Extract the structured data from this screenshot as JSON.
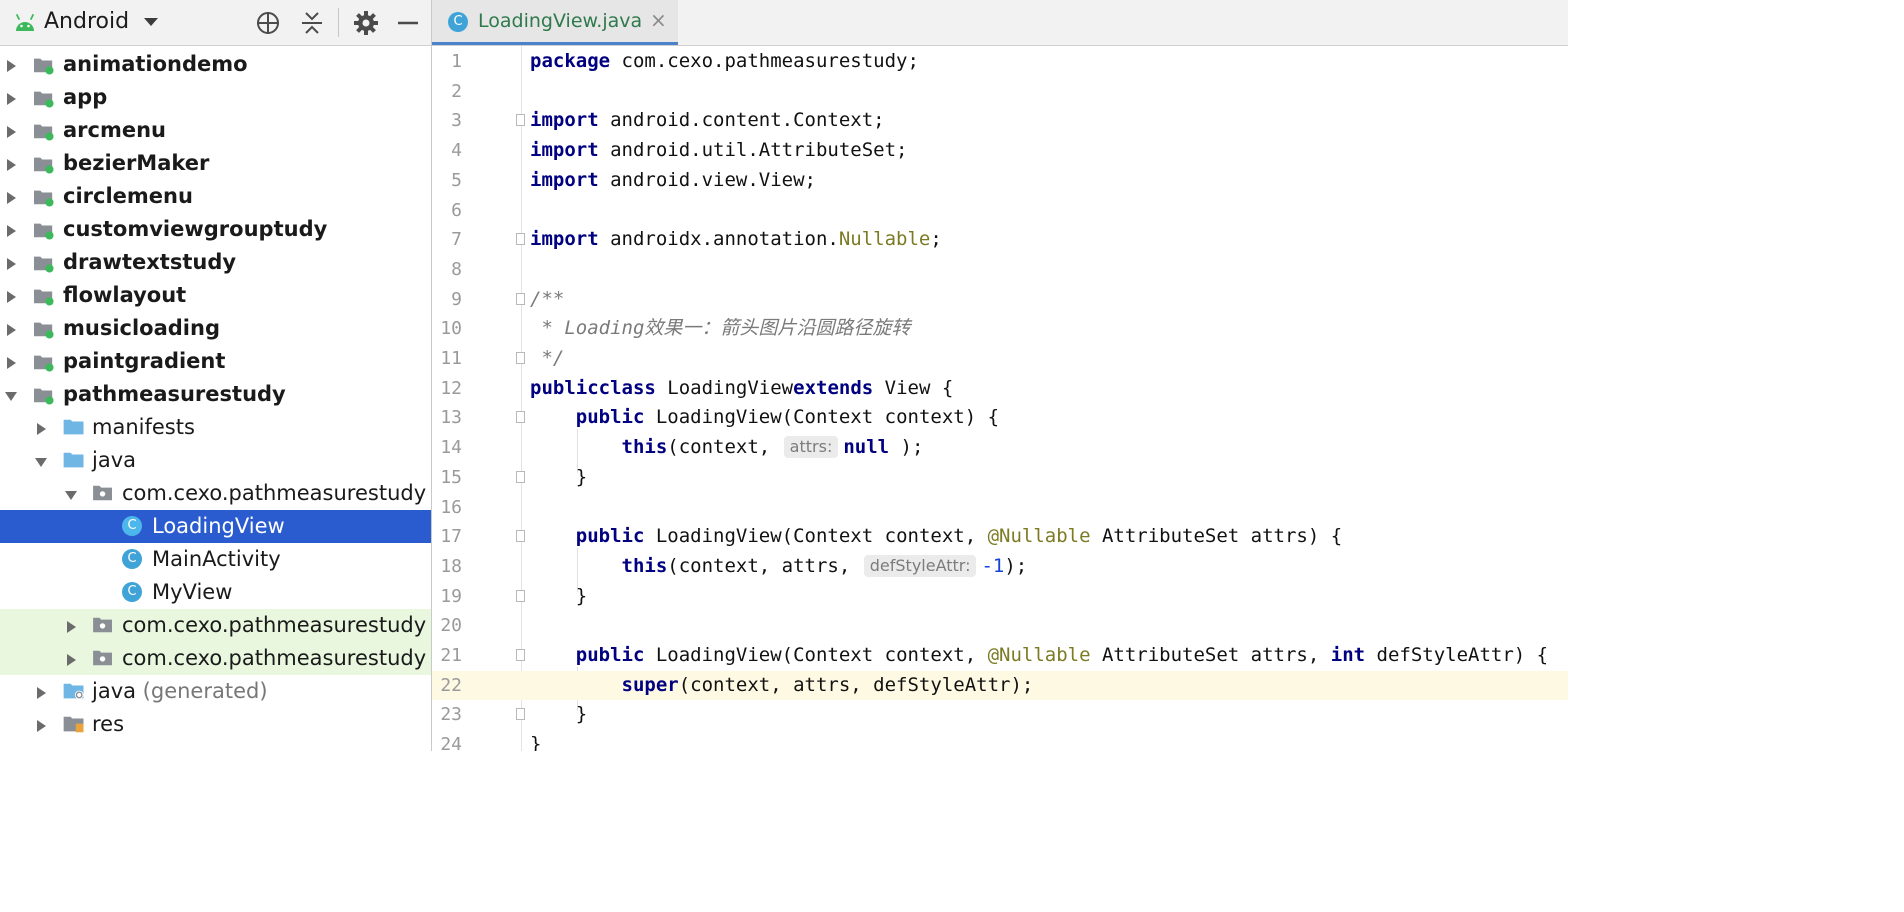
{
  "project_panel": {
    "view_title": "Android",
    "toolbar_icons": [
      "locate-icon",
      "collapse-all-icon",
      "gear-icon",
      "minimize-icon"
    ],
    "tree": [
      {
        "label": "animationdemo",
        "level": 0,
        "kind": "module",
        "expanded": false,
        "bold": true
      },
      {
        "label": "app",
        "level": 0,
        "kind": "module",
        "expanded": false,
        "bold": true
      },
      {
        "label": "arcmenu",
        "level": 0,
        "kind": "module",
        "expanded": false,
        "bold": true
      },
      {
        "label": "bezierMaker",
        "level": 0,
        "kind": "module",
        "expanded": false,
        "bold": true
      },
      {
        "label": "circlemenu",
        "level": 0,
        "kind": "module",
        "expanded": false,
        "bold": true
      },
      {
        "label": "customviewgrouptudy",
        "level": 0,
        "kind": "module",
        "expanded": false,
        "bold": true
      },
      {
        "label": "drawtextstudy",
        "level": 0,
        "kind": "module",
        "expanded": false,
        "bold": true
      },
      {
        "label": "flowlayout",
        "level": 0,
        "kind": "module",
        "expanded": false,
        "bold": true
      },
      {
        "label": "musicloading",
        "level": 0,
        "kind": "module",
        "expanded": false,
        "bold": true
      },
      {
        "label": "paintgradient",
        "level": 0,
        "kind": "module",
        "expanded": false,
        "bold": true
      },
      {
        "label": "pathmeasurestudy",
        "level": 0,
        "kind": "module",
        "expanded": true,
        "bold": true
      },
      {
        "label": "manifests",
        "level": 1,
        "kind": "folder",
        "expanded": false
      },
      {
        "label": "java",
        "level": 1,
        "kind": "folder",
        "expanded": true
      },
      {
        "label": "com.cexo.pathmeasurestudy",
        "level": 2,
        "kind": "package",
        "expanded": true
      },
      {
        "label": "LoadingView",
        "level": 3,
        "kind": "class",
        "selected": true
      },
      {
        "label": "MainActivity",
        "level": 3,
        "kind": "class"
      },
      {
        "label": "MyView",
        "level": 3,
        "kind": "class"
      },
      {
        "label": "com.cexo.pathmeasurestudy",
        "level": 2,
        "kind": "package",
        "expanded": false,
        "tinted": true
      },
      {
        "label": "com.cexo.pathmeasurestudy",
        "level": 2,
        "kind": "package",
        "expanded": false,
        "tinted": true
      },
      {
        "label": "java",
        "suffix": "(generated)",
        "level": 1,
        "kind": "gen-folder",
        "expanded": false
      },
      {
        "label": "res",
        "level": 1,
        "kind": "res-folder",
        "expanded": false
      }
    ]
  },
  "editor": {
    "tab": {
      "icon_letter": "C",
      "label": "LoadingView.java"
    },
    "current_line": 22,
    "lines": [
      {
        "n": "1",
        "tokens": [
          [
            "kw",
            "package"
          ],
          [
            "",
            "com.cexo.pathmeasurestudy;"
          ]
        ]
      },
      {
        "n": "2",
        "tokens": []
      },
      {
        "n": "3",
        "fold": true,
        "tokens": [
          [
            "kw",
            "import"
          ],
          [
            "",
            "android.content.Context;"
          ]
        ]
      },
      {
        "n": "4",
        "tokens": [
          [
            "kw",
            "import"
          ],
          [
            "",
            "android.util.AttributeSet;"
          ]
        ]
      },
      {
        "n": "5",
        "tokens": [
          [
            "kw",
            "import"
          ],
          [
            "",
            "android.view.View;"
          ]
        ]
      },
      {
        "n": "6",
        "tokens": []
      },
      {
        "n": "7",
        "fold": true,
        "tokens": [
          [
            "kw",
            "import"
          ],
          [
            "",
            "androidx.annotation."
          ],
          [
            "ann",
            "Nullable"
          ],
          [
            "",
            ";"
          ]
        ]
      },
      {
        "n": "8",
        "tokens": []
      },
      {
        "n": "9",
        "fold": true,
        "tokens": [
          [
            "cmt",
            "/**"
          ]
        ]
      },
      {
        "n": "10",
        "tokens": [
          [
            "cmt",
            " * Loading效果一：箭头图片沿圆路径旋转"
          ]
        ]
      },
      {
        "n": "11",
        "fold": true,
        "tokens": [
          [
            "cmt",
            " */"
          ]
        ]
      },
      {
        "n": "12",
        "tokens": [
          [
            "kw",
            "public"
          ],
          [
            "",
            ""
          ],
          [
            "kw",
            "class"
          ],
          [
            "",
            "LoadingView"
          ],
          [
            "kw",
            "extends"
          ],
          [
            "",
            "View {"
          ]
        ]
      },
      {
        "n": "13",
        "fold": true,
        "tokens": [
          [
            "",
            "    "
          ],
          [
            "kw",
            "public"
          ],
          [
            "",
            "LoadingView(Context context) {"
          ]
        ]
      },
      {
        "n": "14",
        "tokens": [
          [
            "",
            "        "
          ],
          [
            "kw",
            "this"
          ],
          [
            "",
            "(context, "
          ],
          [
            "hint",
            "attrs:"
          ],
          [
            "kw",
            "null"
          ],
          [
            "",
            ");"
          ]
        ]
      },
      {
        "n": "15",
        "fold": true,
        "tokens": [
          [
            "",
            "    }"
          ]
        ]
      },
      {
        "n": "16",
        "tokens": []
      },
      {
        "n": "17",
        "fold": true,
        "tokens": [
          [
            "",
            "    "
          ],
          [
            "kw",
            "public"
          ],
          [
            "",
            "LoadingView(Context context, "
          ],
          [
            "ann",
            "@Nullable"
          ],
          [
            "",
            "AttributeSet attrs) {"
          ]
        ]
      },
      {
        "n": "18",
        "tokens": [
          [
            "",
            "        "
          ],
          [
            "kw",
            "this"
          ],
          [
            "",
            "(context, attrs, "
          ],
          [
            "hint",
            "defStyleAttr:"
          ],
          [
            "num",
            "-1"
          ],
          [
            "",
            ");"
          ]
        ]
      },
      {
        "n": "19",
        "fold": true,
        "tokens": [
          [
            "",
            "    }"
          ]
        ]
      },
      {
        "n": "20",
        "tokens": []
      },
      {
        "n": "21",
        "fold": true,
        "tokens": [
          [
            "",
            "    "
          ],
          [
            "kw",
            "public"
          ],
          [
            "",
            "LoadingView(Context context, "
          ],
          [
            "ann",
            "@Nullable"
          ],
          [
            "",
            "AttributeSet attrs, "
          ],
          [
            "kw",
            "int"
          ],
          [
            "",
            "defStyleAttr) {"
          ]
        ]
      },
      {
        "n": "22",
        "tokens": [
          [
            "",
            "        "
          ],
          [
            "kw",
            "super"
          ],
          [
            "",
            "(context, attrs, defStyleAttr);"
          ]
        ]
      },
      {
        "n": "23",
        "fold": true,
        "tokens": [
          [
            "",
            "    }"
          ]
        ]
      },
      {
        "n": "24",
        "tokens": [
          [
            "",
            "}"
          ]
        ]
      }
    ]
  },
  "colors": {
    "selection": "#2b5ccf",
    "keyword": "#000080",
    "annotation": "#7c7b24",
    "comment": "#7a7a7a",
    "number": "#1640d9",
    "module_dot": "#3cb95a"
  }
}
